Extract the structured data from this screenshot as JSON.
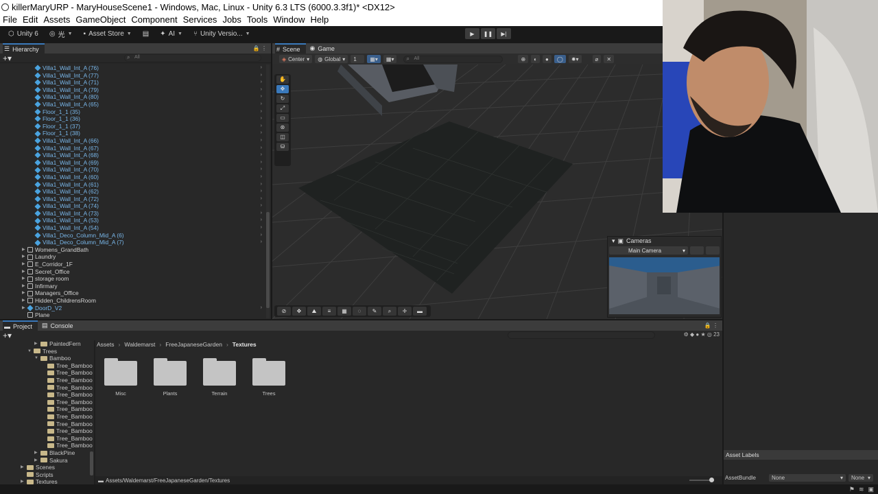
{
  "window": {
    "title": "killerMaryURP - MaryHouseScene1 - Windows, Mac, Linux - Unity 6.3 LTS (6000.3.3f1)* <DX12>"
  },
  "menu": [
    "File",
    "Edit",
    "Assets",
    "GameObject",
    "Component",
    "Services",
    "Jobs",
    "Tools",
    "Window",
    "Help"
  ],
  "toolbar": {
    "unity": "Unity 6",
    "account": "光",
    "asset_store": "Asset Store",
    "ai": "AI",
    "version_control": "Unity Versio..."
  },
  "hierarchy": {
    "tab": "Hierarchy",
    "search_placeholder": "All",
    "children": [
      "Villa1_Wall_Int_A (76)",
      "Villa1_Wall_Int_A (77)",
      "Villa1_Wall_Int_A (71)",
      "Villa1_Wall_Int_A (79)",
      "Villa1_Wall_Int_A (80)",
      "Villa1_Wall_Int_A (65)",
      "Floor_1_1 (35)",
      "Floor_1_1 (36)",
      "Floor_1_1 (37)",
      "Floor_1_1 (38)",
      "Villa1_Wall_Int_A (66)",
      "Villa1_Wall_Int_A (67)",
      "Villa1_Wall_Int_A (68)",
      "Villa1_Wall_Int_A (69)",
      "Villa1_Wall_Int_A (70)",
      "Villa1_Wall_Int_A (60)",
      "Villa1_Wall_Int_A (61)",
      "Villa1_Wall_Int_A (62)",
      "Villa1_Wall_Int_A (72)",
      "Villa1_Wall_Int_A (74)",
      "Villa1_Wall_Int_A (73)",
      "Villa1_Wall_Int_A (53)",
      "Villa1_Wall_Int_A (54)",
      "Villa1_Deco_Column_Mid_A (6)",
      "Villa1_Deco_Column_Mid_A (7)"
    ],
    "roots": [
      "Womens_GrandBath",
      "Laundry",
      "E_Corridor_1F",
      "Secret_Office",
      "storage room",
      "Infirmary",
      "Managers_Office",
      "Hidden_ChildrensRoom",
      "DoorD_V2",
      "Plane"
    ]
  },
  "scene": {
    "tabs": [
      "Scene",
      "Game"
    ],
    "pivot": "Center",
    "space": "Global",
    "grid_snap": "1",
    "search_placeholder": "All",
    "cameras": {
      "title": "Cameras",
      "selected": "Main Camera"
    }
  },
  "project": {
    "tabs": [
      "Project",
      "Console"
    ],
    "count": "23",
    "tree": [
      {
        "label": "PaintedFern",
        "indent": 4,
        "arrow": "▶"
      },
      {
        "label": "Trees",
        "indent": 3,
        "arrow": "▼"
      },
      {
        "label": "Bamboo",
        "indent": 4,
        "arrow": "▼"
      },
      {
        "label": "Tree_Bamboo",
        "indent": 5,
        "arrow": ""
      },
      {
        "label": "Tree_Bamboo",
        "indent": 5,
        "arrow": ""
      },
      {
        "label": "Tree_Bamboo",
        "indent": 5,
        "arrow": ""
      },
      {
        "label": "Tree_Bamboo",
        "indent": 5,
        "arrow": ""
      },
      {
        "label": "Tree_Bamboo",
        "indent": 5,
        "arrow": ""
      },
      {
        "label": "Tree_Bamboo",
        "indent": 5,
        "arrow": ""
      },
      {
        "label": "Tree_Bamboo",
        "indent": 5,
        "arrow": ""
      },
      {
        "label": "Tree_Bamboo",
        "indent": 5,
        "arrow": ""
      },
      {
        "label": "Tree_Bamboo",
        "indent": 5,
        "arrow": ""
      },
      {
        "label": "Tree_Bamboo",
        "indent": 5,
        "arrow": ""
      },
      {
        "label": "Tree_Bamboo",
        "indent": 5,
        "arrow": ""
      },
      {
        "label": "Tree_Bamboo",
        "indent": 5,
        "arrow": ""
      },
      {
        "label": "BlackPine",
        "indent": 4,
        "arrow": "▶"
      },
      {
        "label": "Sakura",
        "indent": 4,
        "arrow": "▶"
      },
      {
        "label": "Scenes",
        "indent": 2,
        "arrow": "▶"
      },
      {
        "label": "Scripts",
        "indent": 2,
        "arrow": ""
      },
      {
        "label": "Textures",
        "indent": 2,
        "arrow": "▶"
      }
    ],
    "breadcrumb": [
      "Assets",
      "Waldemarst",
      "FreeJapaneseGarden",
      "Textures"
    ],
    "folders": [
      "Misc",
      "Plants",
      "Terrain",
      "Trees"
    ],
    "path": "Assets/Waldemarst/FreeJapaneseGarden/Textures"
  },
  "inspector": {
    "asset_labels": "Asset Labels",
    "assetbundle_label": "AssetBundle",
    "assetbundle_value": "None",
    "variant_value": "None"
  }
}
